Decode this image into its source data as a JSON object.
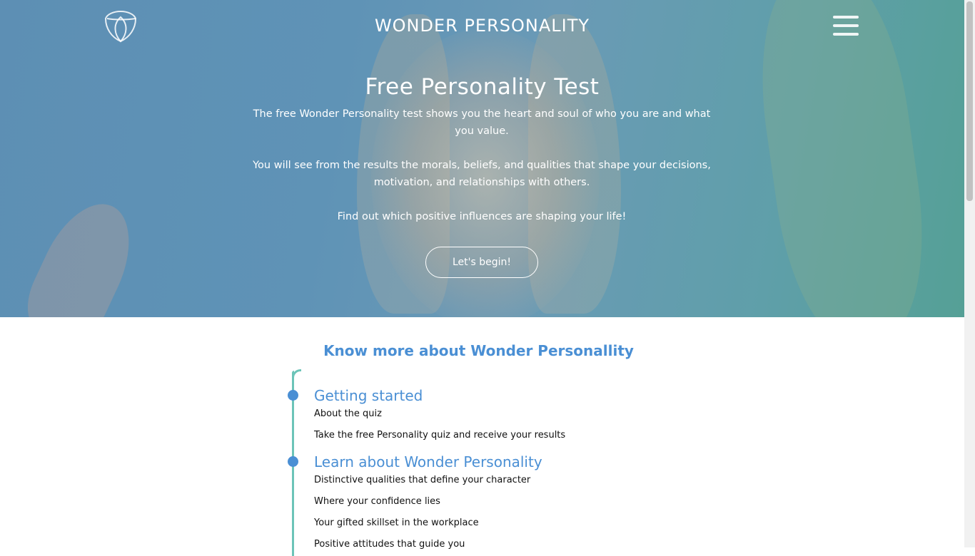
{
  "header": {
    "site_title": "WONDER PERSONALITY",
    "logo_icon": "shield-leaf-logo-icon",
    "menu_icon": "hamburger-menu-icon"
  },
  "hero": {
    "title": "Free Personality Test",
    "paragraphs": [
      "The free Wonder Personality test shows you the heart and soul of who you are and what you value.",
      "You will see from the results the morals, beliefs, and qualities that shape your decisions, motivation, and relationships with others.",
      "Find out which positive influences are shaping your life!"
    ],
    "cta_label": "Let's begin!"
  },
  "about": {
    "title": "Know more about Wonder Personallity",
    "groups": [
      {
        "title": "Getting started",
        "items": [
          "About the quiz",
          "Take the free Personality quiz and receive your results"
        ]
      },
      {
        "title": "Learn about Wonder Personality",
        "items": [
          "Distinctive qualities that define your character",
          "Where your confidence lies",
          "Your gifted skillset in the workplace",
          "Positive attitudes that guide you"
        ]
      }
    ]
  },
  "colors": {
    "accent": "#4a8fd4",
    "timeline": "#6cc4b8",
    "hero_overlay": "#5f93b6"
  }
}
